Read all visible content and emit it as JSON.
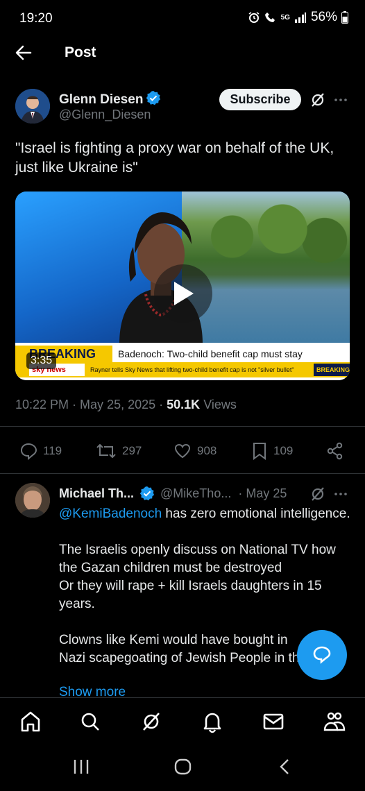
{
  "status_bar": {
    "time": "19:20",
    "battery": "56%",
    "network": "5G"
  },
  "header": {
    "title": "Post",
    "back_icon": "arrow-left-icon"
  },
  "post": {
    "author_name": "Glenn Diesen",
    "author_handle": "@Glenn_Diesen",
    "subscribe_label": "Subscribe",
    "text": "\"Israel is fighting a proxy war on behalf of the UK, just like Ukraine is\"",
    "video": {
      "duration": "3:35",
      "breaking_label": "BREAKING NEWS",
      "headline": "Badenoch: Two-child benefit cap must stay",
      "subline": "Rayner tells Sky News that lifting two-child benefit cap is not \"silver bullet\"",
      "channel": "sky news .com",
      "breaking_small": "BREAKING"
    },
    "time": "10:22 PM",
    "date": "May 25, 2025",
    "views_count": "50.1K",
    "views_label": "Views",
    "stats": {
      "replies": "119",
      "reposts": "297",
      "likes": "908",
      "bookmarks": "109"
    }
  },
  "reply": {
    "author_name": "Michael Th...",
    "author_handle": "@MikeTho...",
    "date": "May 25",
    "mention": "@KemiBadenoch",
    "line1_rest": " has zero emotional intelligence.",
    "para2": "The Israelis openly discuss on National TV how the Gazan children must be destroyed",
    "para3": "Or they will rape + kill Israels daughters in 15 years.",
    "para4": "Clowns like Kemi would have bought in",
    "para5": "Nazi scapegoating of Jewish People in the",
    "show_more": "Show more"
  },
  "colors": {
    "accent": "#1d9bf0",
    "background": "#000000",
    "muted": "#71767b"
  },
  "bottom_nav": [
    "home-icon",
    "search-icon",
    "grok-icon",
    "notifications-icon",
    "messages-icon",
    "communities-icon"
  ]
}
